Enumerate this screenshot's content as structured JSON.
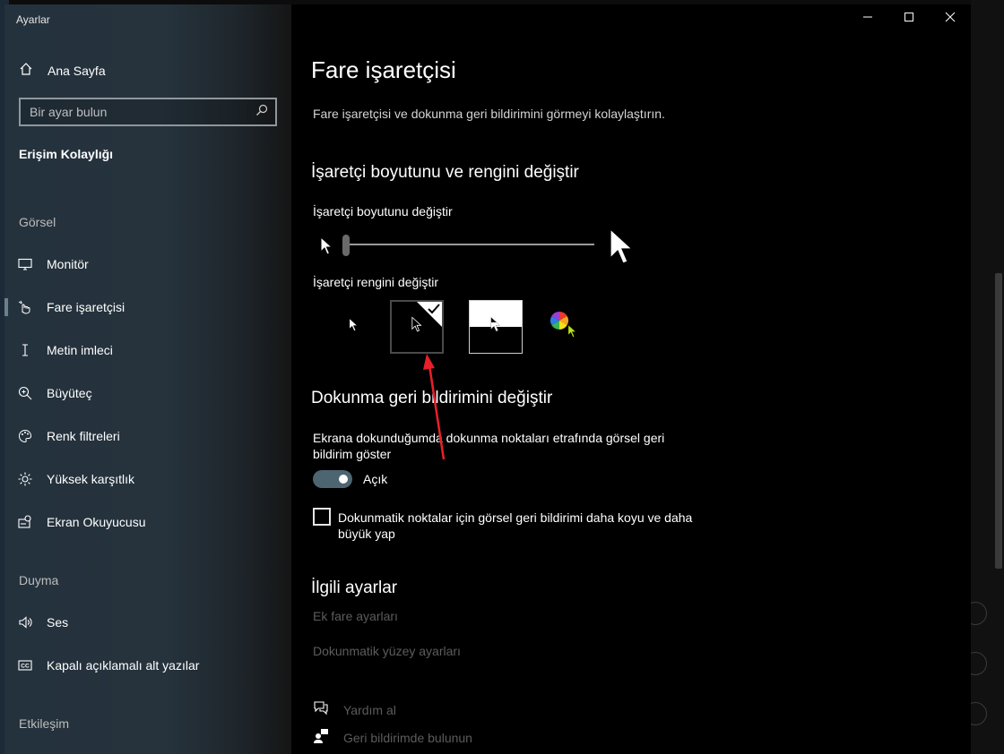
{
  "window": {
    "app_title": "Ayarlar"
  },
  "sidebar": {
    "home_label": "Ana Sayfa",
    "search_placeholder": "Bir ayar bulun",
    "section_title": "Erişim Kolaylığı",
    "groups": [
      {
        "title": "Görsel"
      },
      {
        "title": "Duyma"
      },
      {
        "title": "Etkileşim"
      }
    ],
    "items": [
      {
        "label": "Monitör",
        "icon": "monitor-icon"
      },
      {
        "label": "Fare işaretçisi",
        "icon": "mouse-pointer-icon",
        "selected": true
      },
      {
        "label": "Metin imleci",
        "icon": "text-cursor-icon"
      },
      {
        "label": "Büyüteç",
        "icon": "magnifier-icon"
      },
      {
        "label": "Renk filtreleri",
        "icon": "palette-icon"
      },
      {
        "label": "Yüksek karşıtlık",
        "icon": "sun-icon"
      },
      {
        "label": "Ekran Okuyucusu",
        "icon": "narrator-icon"
      },
      {
        "label": "Ses",
        "icon": "speaker-icon"
      },
      {
        "label": "Kapalı açıklamalı alt yazılar",
        "icon": "closed-caption-icon"
      }
    ]
  },
  "main": {
    "title": "Fare işaretçisi",
    "description": "Fare işaretçisi ve dokunma geri bildirimini görmeyi kolaylaştırın.",
    "pointer_section": {
      "heading": "İşaretçi boyutunu ve rengini değiştir",
      "size_label": "İşaretçi boyutunu değiştir",
      "size_value": 1,
      "color_label": "İşaretçi rengini değiştir",
      "selected_color": "black"
    },
    "touch_section": {
      "heading": "Dokunma geri bildirimini değiştir",
      "toggle_description": "Ekrana dokunduğumda dokunma noktaları etrafında görsel geri bildirim göster",
      "toggle_state": "Açık",
      "checkbox_label": "Dokunmatik noktalar için görsel geri bildirimi daha koyu ve daha büyük yap",
      "checkbox_checked": false
    },
    "related": {
      "heading": "İlgili ayarlar",
      "links": [
        "Ek fare ayarları",
        "Dokunmatik yüzey ayarları"
      ]
    },
    "help": {
      "get_help": "Yardım al",
      "feedback": "Geri bildirimde bulunun"
    }
  },
  "colors": {
    "accent_toggle": "#4d6570",
    "annotation_arrow": "#e8202a",
    "custom_pointer": "#b6e01a"
  }
}
